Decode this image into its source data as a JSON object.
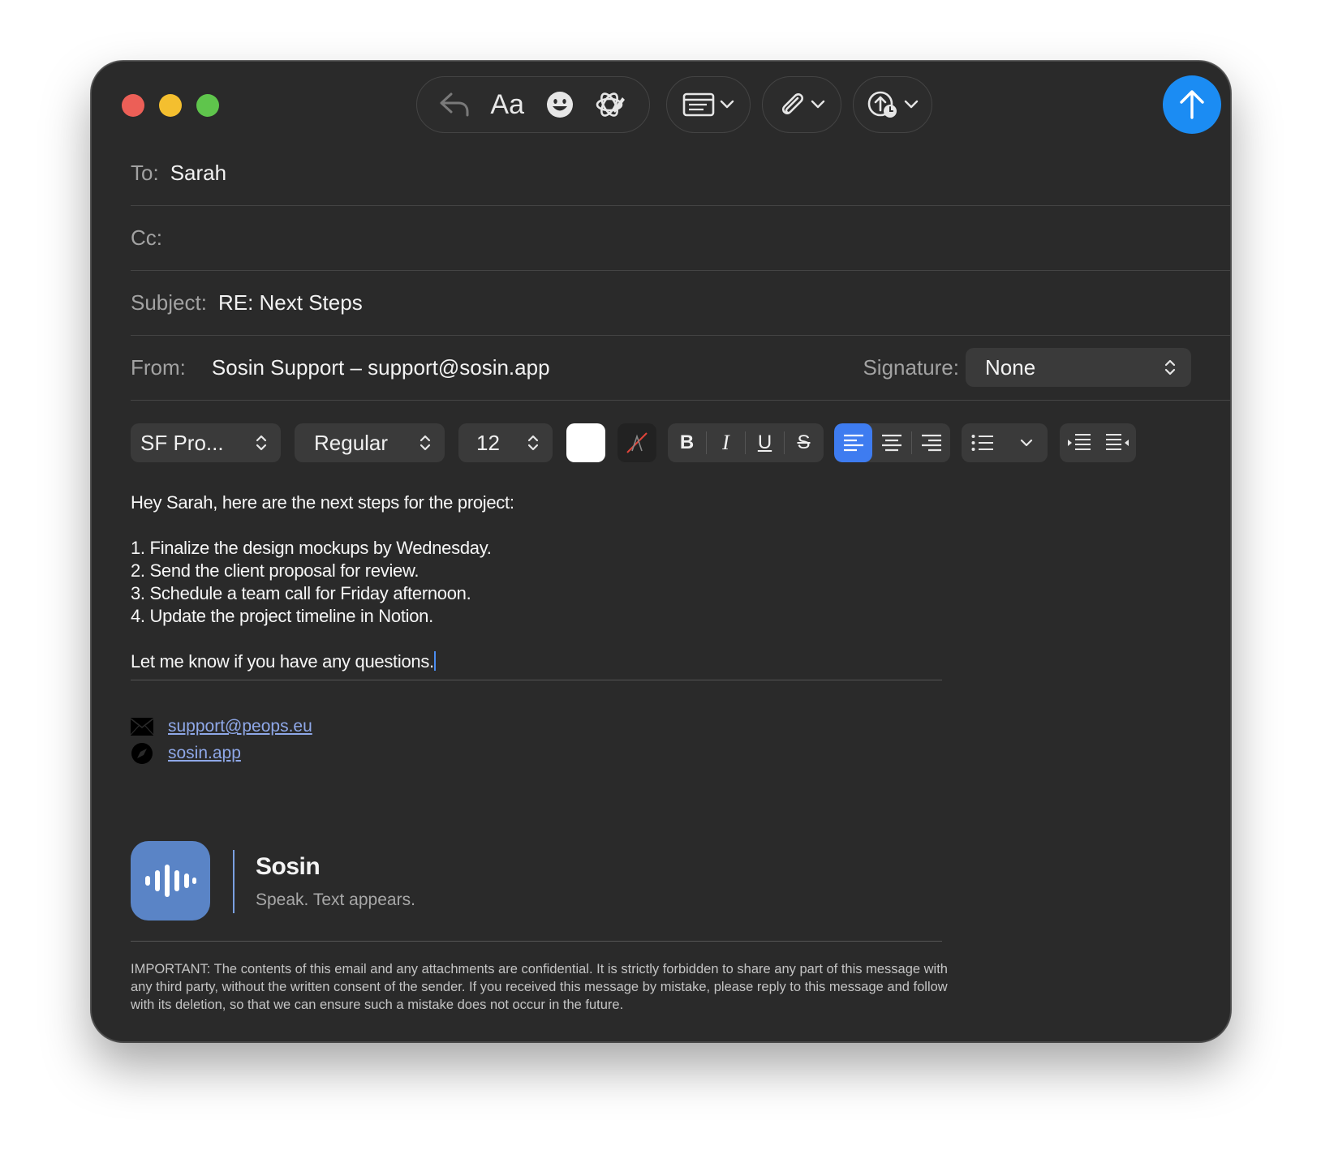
{
  "header": {
    "to_label": "To:",
    "to_value": "Sarah",
    "cc_label": "Cc:",
    "cc_value": "",
    "subject_label": "Subject:",
    "subject_value": "RE: Next Steps",
    "from_label": "From:",
    "from_value": "Sosin Support – support@sosin.app",
    "signature_label": "Signature:",
    "signature_value": "None"
  },
  "toolbar": {
    "font_button_label": "Aa"
  },
  "format": {
    "font_family": "SF Pro...",
    "font_style": "Regular",
    "font_size": "12",
    "bold": "B",
    "italic": "I",
    "underline": "U",
    "strike": "S"
  },
  "body": {
    "greeting": "Hey Sarah, here are the next steps for the project:",
    "items": [
      "1.  Finalize the design mockups by Wednesday.",
      "2.  Send the client proposal for review.",
      "3.  Schedule a team call for Friday afternoon.",
      "4.  Update the project timeline in Notion."
    ],
    "closing": "Let me know if you have any questions."
  },
  "signature": {
    "email": "support@peops.eu",
    "website": "sosin.app",
    "brand": "Sosin",
    "tagline": "Speak. Text appears.",
    "disclaimer": "IMPORTANT: The contents of this email and any attachments are confidential. It is strictly forbidden to share any part of this message with any third party, without the written consent of the sender. If you received this message by mistake, please reply to this message and follow with its deletion, so that we can ensure such a mistake does not occur in the future."
  },
  "colors": {
    "window_bg": "#2a2a2a",
    "send_button": "#1b8cf3",
    "link": "#8fa8e8",
    "logo_bg": "#5a84c6",
    "align_active": "#3e7cf0"
  },
  "icons": [
    "reply-icon",
    "emoji-icon",
    "writing-tools-icon",
    "header-fields-icon",
    "attachment-icon",
    "send-later-icon",
    "send-icon",
    "envelope-icon",
    "compass-icon",
    "waveform-icon"
  ]
}
